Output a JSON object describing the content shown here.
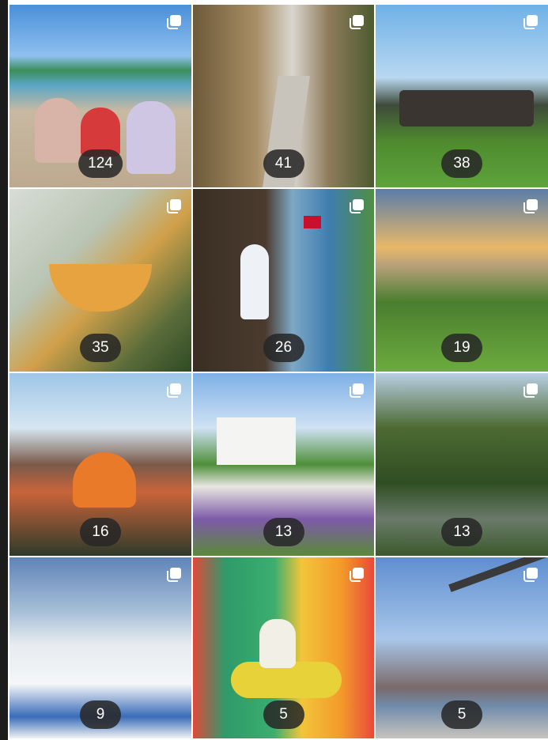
{
  "posts": [
    {
      "count": "124",
      "icon": "carousel-icon"
    },
    {
      "count": "41",
      "icon": "carousel-icon"
    },
    {
      "count": "38",
      "icon": "carousel-icon"
    },
    {
      "count": "35",
      "icon": "carousel-icon"
    },
    {
      "count": "26",
      "icon": "carousel-icon"
    },
    {
      "count": "19",
      "icon": "carousel-icon"
    },
    {
      "count": "16",
      "icon": "carousel-icon"
    },
    {
      "count": "13",
      "icon": "carousel-icon"
    },
    {
      "count": "13",
      "icon": "carousel-icon"
    },
    {
      "count": "9",
      "icon": "carousel-icon"
    },
    {
      "count": "5",
      "icon": "carousel-icon"
    },
    {
      "count": "5",
      "icon": "carousel-icon"
    }
  ],
  "colors": {
    "badge_bg": "#262626",
    "badge_text": "#ffffff"
  }
}
